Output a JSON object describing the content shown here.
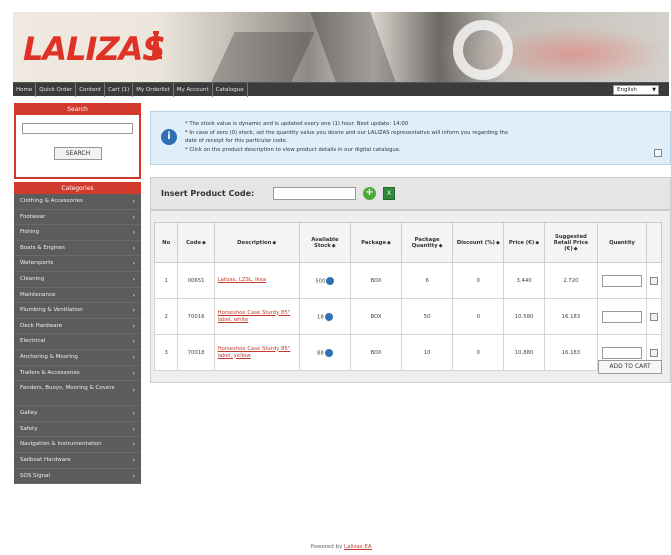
{
  "brand": {
    "logo_text": "LALIZAS",
    "accent_color": "#d23a2e"
  },
  "nav": {
    "items": [
      "Home",
      "Quick Order",
      "Content",
      "Cart (1)",
      "My Orderlist",
      "My Account",
      "Catalogue"
    ],
    "language": "English"
  },
  "search": {
    "title": "Search",
    "button": "SEARCH"
  },
  "categories": {
    "title": "Categories",
    "items": [
      "Clothing & Accessories",
      "Footwear",
      "Fishing",
      "Boats & Engines",
      "Watersports",
      "Cleaning",
      "Maintenance",
      "Plumbing & Ventilation",
      "Deck Hardware",
      "Electrical",
      "Anchoring & Mooring",
      "Trailers & Accessories",
      "Fenders, Buoys, Mooring & Covers",
      "Galley",
      "Safety",
      "Navigation & Instrumentation",
      "Sailboat Hardware",
      "SOS Signal"
    ]
  },
  "info": {
    "line1": "* The stock value is dynamic and is updated every one (1) hour. Next update: 14:00",
    "line2": "* In case of zero (0) stock, set the quantity value you desire and our LALIZAS representative will inform you regarding the",
    "line3": "date of receipt for this particular code.",
    "line4": "* Click on the product description to view product details in our digital catalogue."
  },
  "product_code": {
    "label": "Insert Product Code:",
    "excel_icon": "X"
  },
  "table": {
    "headers": {
      "no": "No",
      "code": "Code",
      "description": "Description",
      "stock": "Available Stock",
      "package": "Package",
      "package_qty": "Package Quantity",
      "discount": "Discount (%)",
      "price": "Price (€)",
      "retail": "Suggested Retail Price (€)",
      "quantity": "Quantity"
    },
    "rows": [
      {
        "no": "1",
        "code": "00651",
        "description": "Lalizas, LZSL, Ikea",
        "stock": "500",
        "package": "BOX",
        "package_qty": "6",
        "discount": "0",
        "price": "3.440",
        "retail": "2.720"
      },
      {
        "no": "2",
        "code": "70016",
        "description": "Horseshoe Case Sturdy 85\" label, white",
        "stock": "18",
        "package": "BOX",
        "package_qty": "50",
        "discount": "0",
        "price": "10.580",
        "retail": "16.183"
      },
      {
        "no": "3",
        "code": "70018",
        "description": "Horseshoe Case Sturdy 85\" label, yellow",
        "stock": "88",
        "package": "BOX",
        "package_qty": "10",
        "discount": "0",
        "price": "10.880",
        "retail": "16.183"
      }
    ],
    "add_to_cart": "ADD TO CART"
  },
  "footer": {
    "prefix": "Powered by",
    "link": "Lalizas EA"
  }
}
